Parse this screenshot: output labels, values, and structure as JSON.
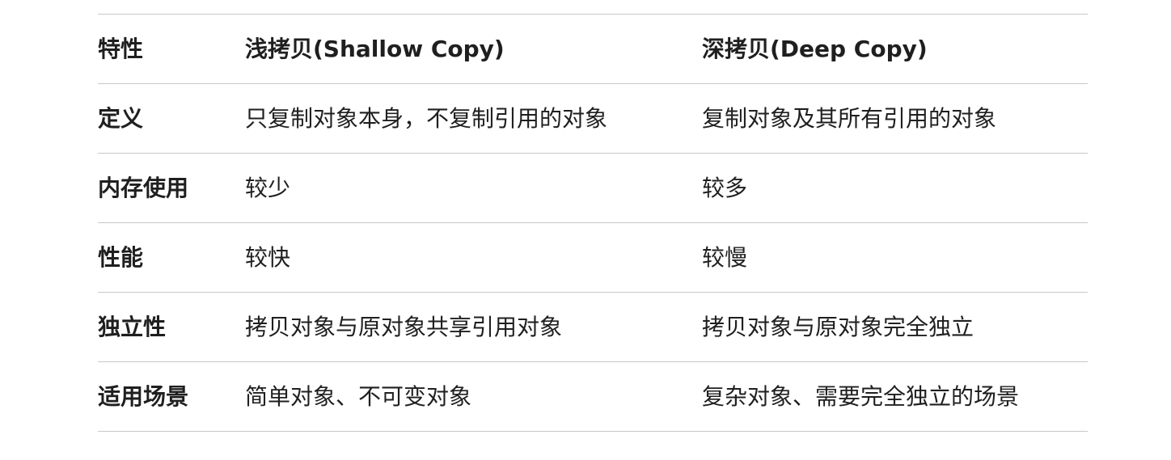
{
  "table": {
    "headers": [
      "特性",
      "浅拷贝(Shallow Copy)",
      "深拷贝(Deep Copy)"
    ],
    "rows": [
      [
        "定义",
        "只复制对象本身，不复制引用的对象",
        "复制对象及其所有引用的对象"
      ],
      [
        "内存使用",
        "较少",
        "较多"
      ],
      [
        "性能",
        "较快",
        "较慢"
      ],
      [
        "独立性",
        "拷贝对象与原对象共享引用对象",
        "拷贝对象与原对象完全独立"
      ],
      [
        "适用场景",
        "简单对象、不可变对象",
        "复杂对象、需要完全独立的场景"
      ]
    ]
  }
}
